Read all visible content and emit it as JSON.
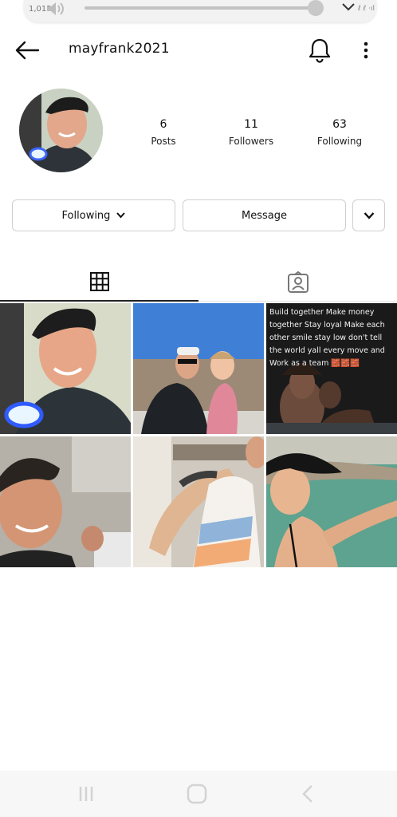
{
  "status_bar": {
    "time": "1,012",
    "right_text": "ℓ ℓ ·ıl"
  },
  "volume": {
    "level": 0.98
  },
  "header": {
    "username": "mayfrank2021",
    "icons": [
      "arrow-left-icon",
      "bell-icon",
      "more-vertical-icon"
    ]
  },
  "profile": {
    "stats": [
      {
        "count": "6",
        "label": "Posts"
      },
      {
        "count": "11",
        "label": "Followers"
      },
      {
        "count": "63",
        "label": "Following"
      }
    ]
  },
  "actions": {
    "following_label": "Following",
    "message_label": "Message"
  },
  "tabs": [
    "grid-icon",
    "tagged-person-icon"
  ],
  "posts": [
    {
      "id": 1,
      "kind": "selfie-teeth-light"
    },
    {
      "id": 2,
      "kind": "man-with-girl-outdoors"
    },
    {
      "id": 3,
      "kind": "quote",
      "text": "Build together Make money together Stay loyal Make each other smile stay low don't tell the world yall every move and Work as a team 🧱🧱🧱"
    },
    {
      "id": 4,
      "kind": "car-selfie"
    },
    {
      "id": 5,
      "kind": "tattooed-arm-tank"
    },
    {
      "id": 6,
      "kind": "lake-hat-selfie"
    }
  ],
  "navbar": [
    "recent-apps-icon",
    "home-icon",
    "back-icon"
  ],
  "colors": {
    "accent": "#111111",
    "border": "#cfcfcf",
    "navbar": "#f7f7f7"
  }
}
